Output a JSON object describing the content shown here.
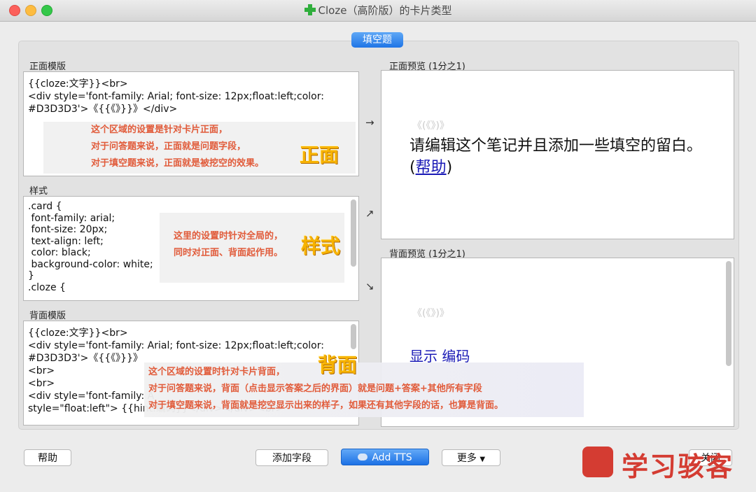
{
  "window": {
    "title": "Cloze（高阶版）的卡片类型"
  },
  "tabs": [
    {
      "label": "填空题"
    }
  ],
  "front_template": {
    "label": "正面模版",
    "lines": [
      "{{cloze:文字}}<br>",
      "<div style='font-family: Arial; font-size: 12px;float:left;color:",
      "#D3D3D3'>《{{《》}}》</div>"
    ]
  },
  "styling": {
    "label": "样式",
    "lines": [
      ".card {",
      " font-family: arial;",
      " font-size: 20px;",
      " text-align: left;",
      " color: black;",
      " background-color: white;",
      "}",
      "",
      ".cloze {"
    ]
  },
  "back_template": {
    "label": "背面模版",
    "lines": [
      "{{cloze:文字}}<br>",
      "<div style='font-family: Arial; font-size: 12px;float:left;color:",
      "#D3D3D3'>《{{《》}}》",
      "<br>",
      "<br>",
      "<div style='font-family: A",
      "style=\"float:left\"> {{hint:编码}}</div></div><br>"
    ]
  },
  "arrows": {
    "top": "→",
    "mid": "↗",
    "bottom": "↘"
  },
  "front_preview": {
    "label": "正面预览 (1分之1)",
    "grey": "《(《》)》",
    "text": "请编辑这个笔记并且添加一些填空的留白。(",
    "link": "帮助",
    "tail": ")"
  },
  "back_preview": {
    "label": "背面预览 (1分之1)",
    "grey": "《(《》)》",
    "link": "显示 编码"
  },
  "annotations": {
    "front": [
      "这个区域的设置是针对卡片正面，",
      "对于问答题来说，正面就是问题字段，",
      "对于填空题来说，正面就是被挖空的效果。"
    ],
    "front_big": "正面",
    "style": [
      "这里的设置时针对全局的，",
      "同时对正面、背面起作用。"
    ],
    "style_big": "样式",
    "back": [
      "这个区域的设置时针对卡片背面，",
      "对于问答题来说，背面（点击显示答案之后的界面）就是问题+答案+其他所有字段",
      "对于填空题来说，背面就是挖空显示出来的样子，如果还有其他字段的话，也算是背面。"
    ],
    "back_big": "背面"
  },
  "buttons": {
    "help": "帮助",
    "add_field": "添加字段",
    "add_tts": "Add TTS",
    "more": "更多",
    "close": "关闭"
  },
  "watermark": {
    "text": "学习骇客"
  }
}
